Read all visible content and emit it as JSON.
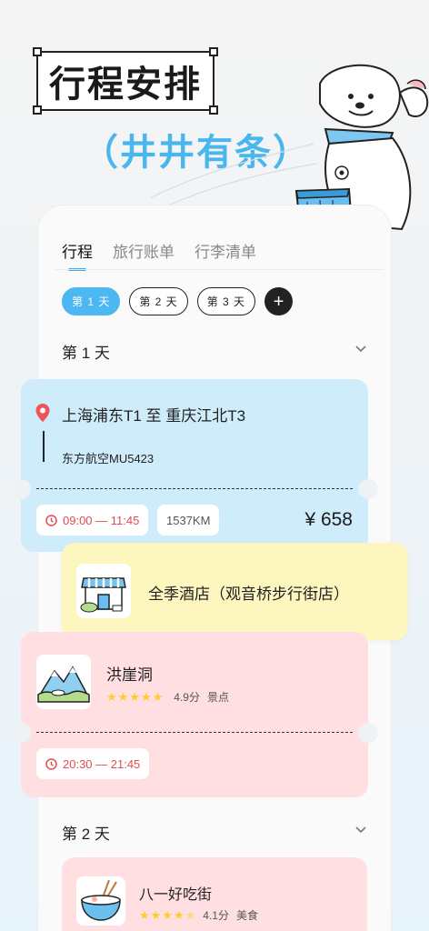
{
  "hero": {
    "title": "行程安排",
    "subtitle": "（井井有条）"
  },
  "tabs": [
    {
      "label": "行程",
      "active": true
    },
    {
      "label": "旅行账单",
      "active": false
    },
    {
      "label": "行李清单",
      "active": false
    }
  ],
  "day_pills": [
    {
      "label": "第 1 天",
      "active": true
    },
    {
      "label": "第 2 天",
      "active": false
    },
    {
      "label": "第 3 天",
      "active": false
    }
  ],
  "add_day_label": "+",
  "days": [
    {
      "header": "第 1 天"
    },
    {
      "header": "第 2 天"
    }
  ],
  "flight": {
    "route": "上海浦东T1 至 重庆江北T3",
    "airline": "东方航空MU5423",
    "time": "09:00 — 11:45",
    "distance": "1537KM",
    "price": "¥ 658"
  },
  "hotel": {
    "name": "全季酒店（观音桥步行街店）"
  },
  "scenic": {
    "name": "洪崖洞",
    "stars": 5,
    "score": "4.9分",
    "category": "景点",
    "time": "20:30 — 21:45"
  },
  "food": {
    "name": "八一好吃街",
    "stars": 4.5,
    "score": "4.1分",
    "category": "美食"
  },
  "colors": {
    "accent_blue": "#4cb7f1",
    "flight_card": "#cfecfb",
    "hotel_card": "#fdf6bf",
    "scenic_card": "#ffdfe2",
    "time_red": "#e44b50",
    "star_yellow": "#ffcc2a"
  },
  "icons": [
    "location-pin-icon",
    "clock-icon",
    "chevron-down-icon",
    "plus-icon",
    "star-icon",
    "hotel-thumbnail",
    "mountain-thumbnail",
    "noodle-bowl-thumbnail",
    "dog-mascot"
  ]
}
